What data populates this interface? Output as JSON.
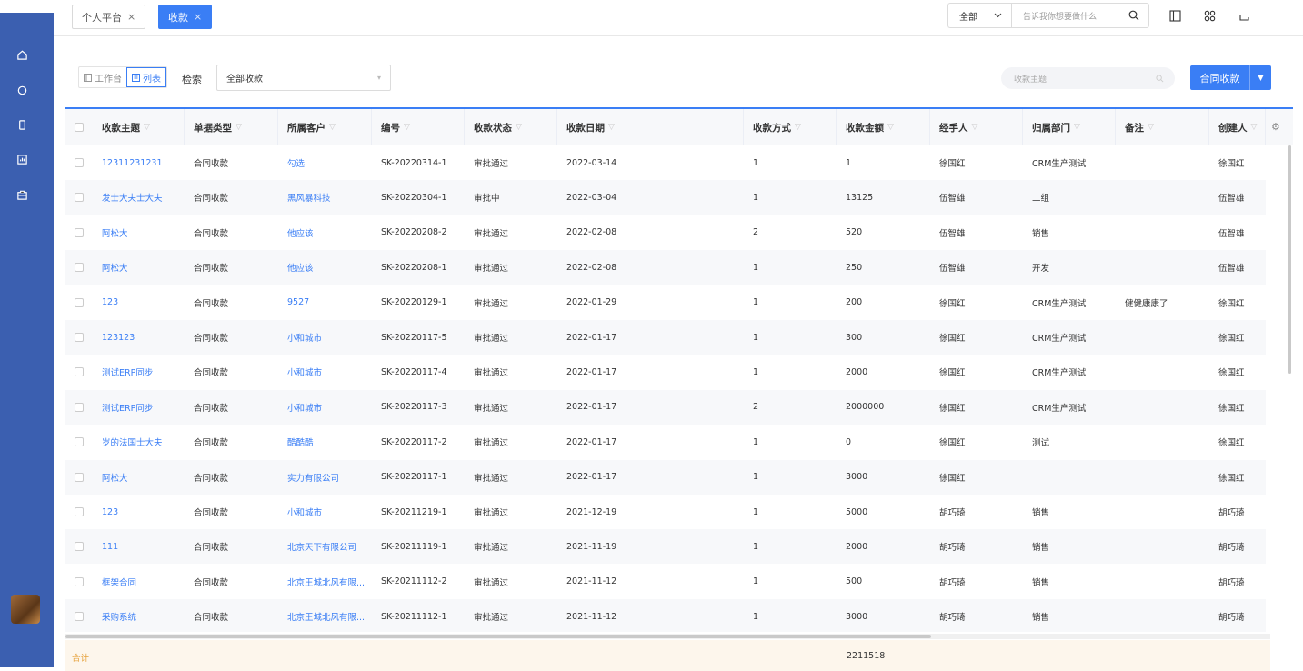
{
  "sidebar": {
    "icons": [
      "home-icon",
      "refresh-icon",
      "phone-icon",
      "report-icon",
      "briefcase-icon"
    ]
  },
  "tabs": [
    {
      "label": "个人平台",
      "close": "×"
    },
    {
      "label": "收款",
      "close": "×"
    }
  ],
  "top": {
    "scope": "全部",
    "search_placeholder": "告诉我你想要做什么"
  },
  "toolbar": {
    "view_workbench": "工作台",
    "view_list": "列表",
    "filter_label": "检索",
    "filter_value": "全部收款",
    "subject_search_placeholder": "收款主题",
    "create_button": "合同收款"
  },
  "table": {
    "columns": [
      "收款主题",
      "单据类型",
      "所属客户",
      "编号",
      "收款状态",
      "收款日期",
      "收款方式",
      "收款金额",
      "经手人",
      "归属部门",
      "备注",
      "创建人"
    ],
    "rows": [
      [
        "12311231231",
        "合同收款",
        "勾选",
        "SK-20220314-1",
        "审批通过",
        "2022-03-14",
        "1",
        "1",
        "徐国红",
        "CRM生产测试",
        "",
        "徐国红"
      ],
      [
        "发士大夫士大夫",
        "合同收款",
        "黑风暴科技",
        "SK-20220304-1",
        "审批中",
        "2022-03-04",
        "1",
        "13125",
        "伍智雄",
        "二组",
        "",
        "伍智雄"
      ],
      [
        "阿松大",
        "合同收款",
        "他应该",
        "SK-20220208-2",
        "审批通过",
        "2022-02-08",
        "2",
        "520",
        "伍智雄",
        "销售",
        "",
        "伍智雄"
      ],
      [
        "阿松大",
        "合同收款",
        "他应该",
        "SK-20220208-1",
        "审批通过",
        "2022-02-08",
        "1",
        "250",
        "伍智雄",
        "开发",
        "",
        "伍智雄"
      ],
      [
        "123",
        "合同收款",
        "9527",
        "SK-20220129-1",
        "审批通过",
        "2022-01-29",
        "1",
        "200",
        "徐国红",
        "CRM生产测试",
        "健健康康了",
        "徐国红"
      ],
      [
        "123123",
        "合同收款",
        "小和城市",
        "SK-20220117-5",
        "审批通过",
        "2022-01-17",
        "1",
        "300",
        "徐国红",
        "CRM生产测试",
        "",
        "徐国红"
      ],
      [
        "测试ERP同步",
        "合同收款",
        "小和城市",
        "SK-20220117-4",
        "审批通过",
        "2022-01-17",
        "1",
        "2000",
        "徐国红",
        "CRM生产测试",
        "",
        "徐国红"
      ],
      [
        "测试ERP同步",
        "合同收款",
        "小和城市",
        "SK-20220117-3",
        "审批通过",
        "2022-01-17",
        "2",
        "2000000",
        "徐国红",
        "CRM生产测试",
        "",
        "徐国红"
      ],
      [
        "岁的法国士大夫",
        "合同收款",
        "酷酷酷",
        "SK-20220117-2",
        "审批通过",
        "2022-01-17",
        "1",
        "0",
        "徐国红",
        "测试",
        "",
        "徐国红"
      ],
      [
        "阿松大",
        "合同收款",
        "实力有限公司",
        "SK-20220117-1",
        "审批通过",
        "2022-01-17",
        "1",
        "3000",
        "徐国红",
        "",
        "",
        "徐国红"
      ],
      [
        "123",
        "合同收款",
        "小和城市",
        "SK-20211219-1",
        "审批通过",
        "2021-12-19",
        "1",
        "5000",
        "胡巧琦",
        "销售",
        "",
        "胡巧琦"
      ],
      [
        "111",
        "合同收款",
        "北京天下有限公司",
        "SK-20211119-1",
        "审批通过",
        "2021-11-19",
        "1",
        "2000",
        "胡巧琦",
        "销售",
        "",
        "胡巧琦"
      ],
      [
        "框架合同",
        "合同收款",
        "北京王城北风有限...",
        "SK-20211112-2",
        "审批通过",
        "2021-11-12",
        "1",
        "500",
        "胡巧琦",
        "销售",
        "",
        "胡巧琦"
      ],
      [
        "采购系统",
        "合同收款",
        "北京王城北风有限...",
        "SK-20211112-1",
        "审批通过",
        "2021-11-12",
        "1",
        "3000",
        "胡巧琦",
        "销售",
        "",
        "胡巧琦"
      ]
    ],
    "footer_label": "合计",
    "footer_total": "2211518"
  },
  "colors": {
    "sidebar": "#3b5fb0",
    "accent": "#3a7ef5",
    "footer_bg": "#fdf6ec",
    "footer_label": "#e6a23c"
  }
}
